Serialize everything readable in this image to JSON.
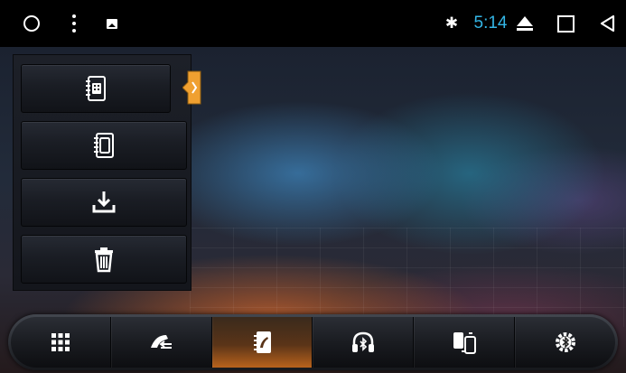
{
  "status_bar": {
    "clock": "5:14",
    "clock_color": "#33b5e5",
    "icons": [
      "circle-icon",
      "overflow-menu-icon",
      "image-notification-icon",
      "bluetooth-icon",
      "eject-icon",
      "recent-apps-icon",
      "back-icon"
    ]
  },
  "side_menu": {
    "items": [
      {
        "icon": "phonebook-sim-icon",
        "selected": true
      },
      {
        "icon": "phonebook-phone-icon",
        "selected": false
      },
      {
        "icon": "download-icon",
        "selected": false
      },
      {
        "icon": "trash-icon",
        "selected": false
      }
    ],
    "selection_accent": "#f0a030"
  },
  "dock": {
    "items": [
      {
        "icon": "dialpad-icon",
        "active": false
      },
      {
        "icon": "call-log-icon",
        "active": false
      },
      {
        "icon": "contacts-icon",
        "active": true
      },
      {
        "icon": "bluetooth-music-icon",
        "active": false
      },
      {
        "icon": "device-connect-icon",
        "active": false
      },
      {
        "icon": "bluetooth-settings-icon",
        "active": false
      }
    ],
    "active_color": "#b8621c"
  }
}
